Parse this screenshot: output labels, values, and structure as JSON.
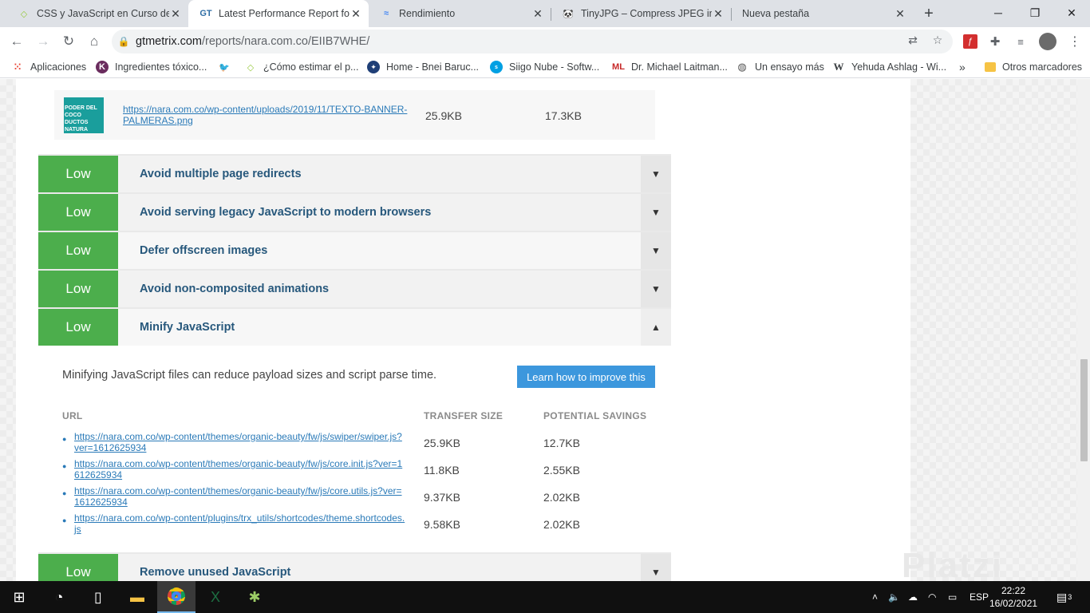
{
  "tabs": [
    {
      "title": "CSS y JavaScript en Curso de S",
      "icon": "platzi-icon",
      "active": false
    },
    {
      "title": "Latest Performance Report for",
      "icon": "gtmetrix-icon",
      "active": true
    },
    {
      "title": "Rendimiento",
      "icon": "pagespeed-icon",
      "active": false
    },
    {
      "title": "TinyJPG – Compress JPEG imag",
      "icon": "panda-icon",
      "active": false
    },
    {
      "title": "Nueva pestaña",
      "icon": "",
      "active": false
    }
  ],
  "address_bar": {
    "domain": "gtmetrix.com",
    "path": "/reports/nara.com.co/EIIB7WHE/"
  },
  "bookmarks": [
    {
      "label": "Aplicaciones",
      "icon": "apps-grid-icon"
    },
    {
      "label": "Ingredientes tóxico...",
      "icon": "bookmark-site-icon"
    },
    {
      "label": "",
      "icon": "twitter-icon"
    },
    {
      "label": "¿Cómo estimar el p...",
      "icon": "platzi-icon"
    },
    {
      "label": "Home - Bnei Baruc...",
      "icon": "bnei-icon"
    },
    {
      "label": "Siigo Nube - Softw...",
      "icon": "siigo-icon"
    },
    {
      "label": "Dr. Michael Laitman...",
      "icon": "ml-icon"
    },
    {
      "label": "Un ensayo más",
      "icon": "globe-icon"
    },
    {
      "label": "Yehuda Ashlag - Wi...",
      "icon": "wikipedia-icon"
    }
  ],
  "bookmarks_more": "»",
  "other_bookmarks": "Otros marcadores",
  "image_row": {
    "thumb_text": "PODER DEL COCO DUCTOS NATURA",
    "url": "https://nara.com.co/wp-content/uploads/2019/11/TEXTO-BANNER-PALMERAS.png",
    "transfer": "25.9KB",
    "savings": "17.3KB"
  },
  "recommendations": [
    {
      "priority": "Low",
      "title": "Avoid multiple page redirects",
      "expanded": false
    },
    {
      "priority": "Low",
      "title": "Avoid serving legacy JavaScript to modern browsers",
      "expanded": false
    },
    {
      "priority": "Low",
      "title": "Defer offscreen images",
      "expanded": false
    },
    {
      "priority": "Low",
      "title": "Avoid non-composited animations",
      "expanded": false
    },
    {
      "priority": "Low",
      "title": "Minify JavaScript",
      "expanded": true
    }
  ],
  "minify": {
    "description": "Minifying JavaScript files can reduce payload sizes and script parse time.",
    "learn_button": "Learn how to improve this",
    "headers": {
      "url": "URL",
      "transfer": "TRANSFER SIZE",
      "savings": "POTENTIAL SAVINGS"
    },
    "rows": [
      {
        "url": "https://nara.com.co/wp-content/themes/organic-beauty/fw/js/swiper/swiper.js?ver=1612625934",
        "transfer": "25.9KB",
        "savings": "12.7KB"
      },
      {
        "url": "https://nara.com.co/wp-content/themes/organic-beauty/fw/js/core.init.js?ver=1612625934",
        "transfer": "11.8KB",
        "savings": "2.55KB"
      },
      {
        "url": "https://nara.com.co/wp-content/themes/organic-beauty/fw/js/core.utils.js?ver=1612625934",
        "transfer": "9.37KB",
        "savings": "2.02KB"
      },
      {
        "url": "https://nara.com.co/wp-content/plugins/trx_utils/shortcodes/theme.shortcodes.js",
        "transfer": "9.58KB",
        "savings": "2.02KB"
      }
    ]
  },
  "next_recommendation": {
    "priority": "Low",
    "title": "Remove unused JavaScript"
  },
  "watermark": "Platzi",
  "taskbar": {
    "lang": "ESP",
    "time": "22:22",
    "date": "16/02/2021",
    "notifications": "3"
  },
  "colors": {
    "low_badge": "#4cae4c",
    "title_text": "#27587c",
    "link": "#2a7ab8",
    "button": "#3c97dd"
  }
}
